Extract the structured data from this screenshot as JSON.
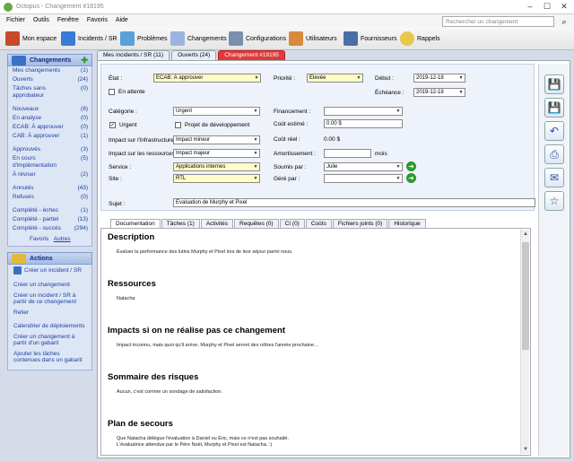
{
  "window": {
    "title": "Octopus - Changement #18195"
  },
  "menu": [
    "Fichier",
    "Outils",
    "Fenêtre",
    "Favoris",
    "Aide"
  ],
  "search": {
    "placeholder": "Rechercher un changement"
  },
  "toolbar": [
    "Mon espace",
    "Incidents / SR",
    "Problèmes",
    "Changements",
    "Configurations",
    "Utilisateurs",
    "Fournisseurs",
    "Rappels"
  ],
  "sidebar": {
    "title": "Changements",
    "items": [
      {
        "label": "Mes changements",
        "count": "(1)"
      },
      {
        "label": "Ouverts",
        "count": "(24)"
      },
      {
        "label": "Tâches sans approbateur",
        "count": "(0)"
      },
      {
        "label": "Nouveaux",
        "count": "(8)"
      },
      {
        "label": "En analyse",
        "count": "(0)"
      },
      {
        "label": "ECAB: À approuver",
        "count": "(0)"
      },
      {
        "label": "CAB: À approuver",
        "count": "(1)"
      },
      {
        "label": "Approuvés",
        "count": "(3)"
      },
      {
        "label": "En cours d'implémentation",
        "count": "(5)"
      },
      {
        "label": "À réviser",
        "count": "(2)"
      },
      {
        "label": "Annulés",
        "count": "(43)"
      },
      {
        "label": "Refusés",
        "count": "(0)"
      },
      {
        "label": "Complété - échec",
        "count": "(1)"
      },
      {
        "label": "Complété - partiel",
        "count": "(13)"
      },
      {
        "label": "Complété - succès",
        "count": "(294)"
      }
    ],
    "favorites": "Favoris",
    "others": "Autres"
  },
  "actions": {
    "title": "Actions",
    "items": [
      "Créer un incident / SR",
      "Créer un changement",
      "Créer un incident / SR à partir de ce changement",
      "Relier",
      "Calendrier de déploiements",
      "Créer un changement à partir d'un gabarit",
      "Ajouter les tâches contenues dans un gabarit"
    ]
  },
  "tabs": [
    "Mes incidents / SR (11)",
    "Ouverts (24)",
    "Changement #18195"
  ],
  "form": {
    "etat_label": "État :",
    "etat_value": "ECAB: À approuver",
    "attente_label": "En attente",
    "priorite_label": "Priorité :",
    "priorite_value": "Élevée",
    "debut_label": "Début :",
    "debut_value": "2019-12-18",
    "echeance_label": "Échéance :",
    "echeance_value": "2019-12-18",
    "categorie_label": "Catégorie :",
    "categorie_value": "Urgent",
    "urgent_label": "Urgent",
    "projet_label": "Projet de développement",
    "financement_label": "Financement :",
    "financement_value": "",
    "cout_estime_label": "Coût estimé :",
    "cout_estime_value": "0.00 $",
    "cout_reel_label": "Coût réel :",
    "cout_reel_value": "0.00 $",
    "impact_infra_label": "Impact sur l'infrastructure :",
    "impact_infra_value": "Impact mineur",
    "impact_res_label": "Impact sur les ressources :",
    "impact_res_value": "Impact majeur",
    "amort_label": "Amortissement :",
    "amort_value": "",
    "amort_unit": "mois",
    "service_label": "Service :",
    "service_value": "Applications internes",
    "site_label": "Site :",
    "site_value": "RTL",
    "soumis_label": "Soumis par :",
    "soumis_value": "Julie",
    "gere_label": "Géré par :",
    "gere_value": "",
    "sujet_label": "Sujet :",
    "sujet_value": "Évaluation de Murphy et Pixel"
  },
  "doc_tabs": [
    "Documentation",
    "Tâches (1)",
    "Activités",
    "Requêtes (0)",
    "CI (0)",
    "Coûts",
    "Fichiers joints (0)",
    "Historique"
  ],
  "doc": {
    "description_title": "Description",
    "description_text": "Évaluer la performance des lutins Murphy et Pixel lors de leur séjour parmi nous.",
    "ressources_title": "Ressources",
    "ressources_text": "Natacha",
    "impacts_title": "Impacts si on ne réalise pas ce changement",
    "impacts_text": "Impact inconnu, mais quoi qu'il arrive, Murphy et Pixel seront des nôtres l'année prochaine…",
    "risques_title": "Sommaire des risques",
    "risques_text": "Aucun, c'est comme un sondage de satisfaction.",
    "secours_title": "Plan de secours",
    "secours_text1": "Que Natacha délègue l'évaluation à Daniel ou Éric, mais ce n'est pas souhaité.",
    "secours_text2": "L'évaluatrice attendue par le Père Noël, Murphy et Pixel est Natacha. :)"
  }
}
